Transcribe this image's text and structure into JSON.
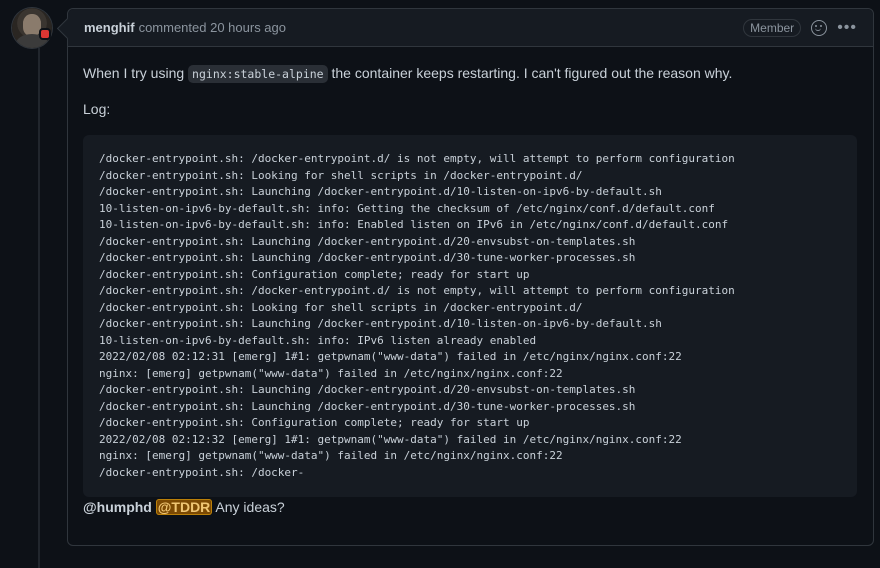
{
  "comment": {
    "author": "menghif",
    "action": "commented",
    "time": "20 hours ago",
    "badge": "Member",
    "intro_before": "When I try using",
    "intro_code": "nginx:stable-alpine",
    "intro_after": "the container keeps restarting. I can't figured out the reason why.",
    "log_label": "Log:",
    "log_lines": [
      "/docker-entrypoint.sh: /docker-entrypoint.d/ is not empty, will attempt to perform configuration",
      "/docker-entrypoint.sh: Looking for shell scripts in /docker-entrypoint.d/",
      "/docker-entrypoint.sh: Launching /docker-entrypoint.d/10-listen-on-ipv6-by-default.sh",
      "10-listen-on-ipv6-by-default.sh: info: Getting the checksum of /etc/nginx/conf.d/default.conf",
      "10-listen-on-ipv6-by-default.sh: info: Enabled listen on IPv6 in /etc/nginx/conf.d/default.conf",
      "/docker-entrypoint.sh: Launching /docker-entrypoint.d/20-envsubst-on-templates.sh",
      "/docker-entrypoint.sh: Launching /docker-entrypoint.d/30-tune-worker-processes.sh",
      "/docker-entrypoint.sh: Configuration complete; ready for start up",
      "/docker-entrypoint.sh: /docker-entrypoint.d/ is not empty, will attempt to perform configuration",
      "/docker-entrypoint.sh: Looking for shell scripts in /docker-entrypoint.d/",
      "/docker-entrypoint.sh: Launching /docker-entrypoint.d/10-listen-on-ipv6-by-default.sh",
      "10-listen-on-ipv6-by-default.sh: info: IPv6 listen already enabled",
      "2022/02/08 02:12:31 [emerg] 1#1: getpwnam(\"www-data\") failed in /etc/nginx/nginx.conf:22",
      "nginx: [emerg] getpwnam(\"www-data\") failed in /etc/nginx/nginx.conf:22",
      "/docker-entrypoint.sh: Launching /docker-entrypoint.d/20-envsubst-on-templates.sh",
      "/docker-entrypoint.sh: Launching /docker-entrypoint.d/30-tune-worker-processes.sh",
      "/docker-entrypoint.sh: Configuration complete; ready for start up",
      "2022/02/08 02:12:32 [emerg] 1#1: getpwnam(\"www-data\") failed in /etc/nginx/nginx.conf:22",
      "nginx: [emerg] getpwnam(\"www-data\") failed in /etc/nginx/nginx.conf:22",
      "/docker-entrypoint.sh: /docker-"
    ],
    "mention_1": "@humphd",
    "mention_2": "@TDDR",
    "question": "Any ideas?"
  },
  "colors": {
    "background": "#0d1117",
    "header_bg": "#161b22",
    "border": "#30363d",
    "mention_highlight": "#7c4a03"
  }
}
